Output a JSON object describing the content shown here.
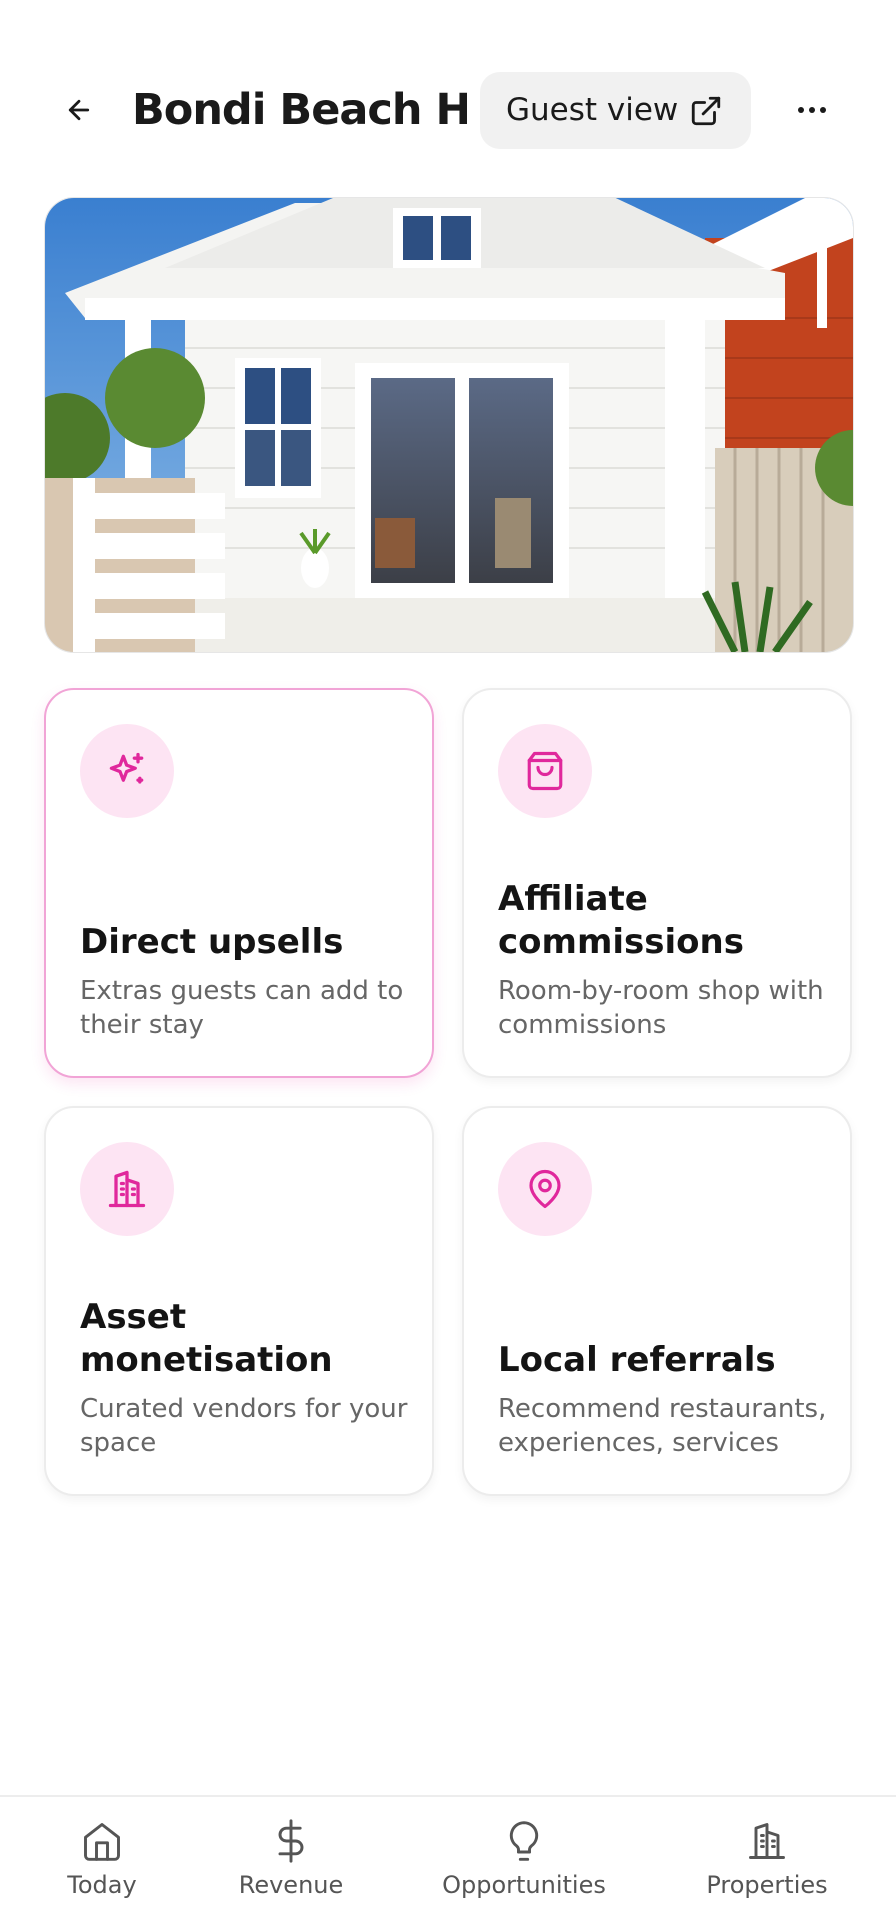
{
  "header": {
    "title": "Bondi Beach H...",
    "guest_view_label": "Guest view"
  },
  "hero": {
    "alt": "White beach cottage with french doors"
  },
  "cards": [
    {
      "title": "Direct upsells",
      "description": "Extras guests can add to their stay",
      "icon": "sparkles-icon",
      "selected": true
    },
    {
      "title": "Affiliate commissions",
      "description": "Room-by-room shop with commissions",
      "icon": "shopping-bag-icon",
      "selected": false
    },
    {
      "title": "Asset monetisation",
      "description": "Curated vendors for your space",
      "icon": "building-icon",
      "selected": false
    },
    {
      "title": "Local referrals",
      "description": "Recommend restaurants, experiences, services",
      "icon": "map-pin-icon",
      "selected": false
    }
  ],
  "nav": {
    "items": [
      {
        "label": "Today",
        "icon": "home-icon"
      },
      {
        "label": "Revenue",
        "icon": "dollar-icon"
      },
      {
        "label": "Opportunities",
        "icon": "lightbulb-icon"
      },
      {
        "label": "Properties",
        "icon": "building-icon"
      }
    ]
  },
  "colors": {
    "accent": "#e0289c",
    "accent_bg": "#fde4f3",
    "selected_border": "#f1a4d6"
  }
}
